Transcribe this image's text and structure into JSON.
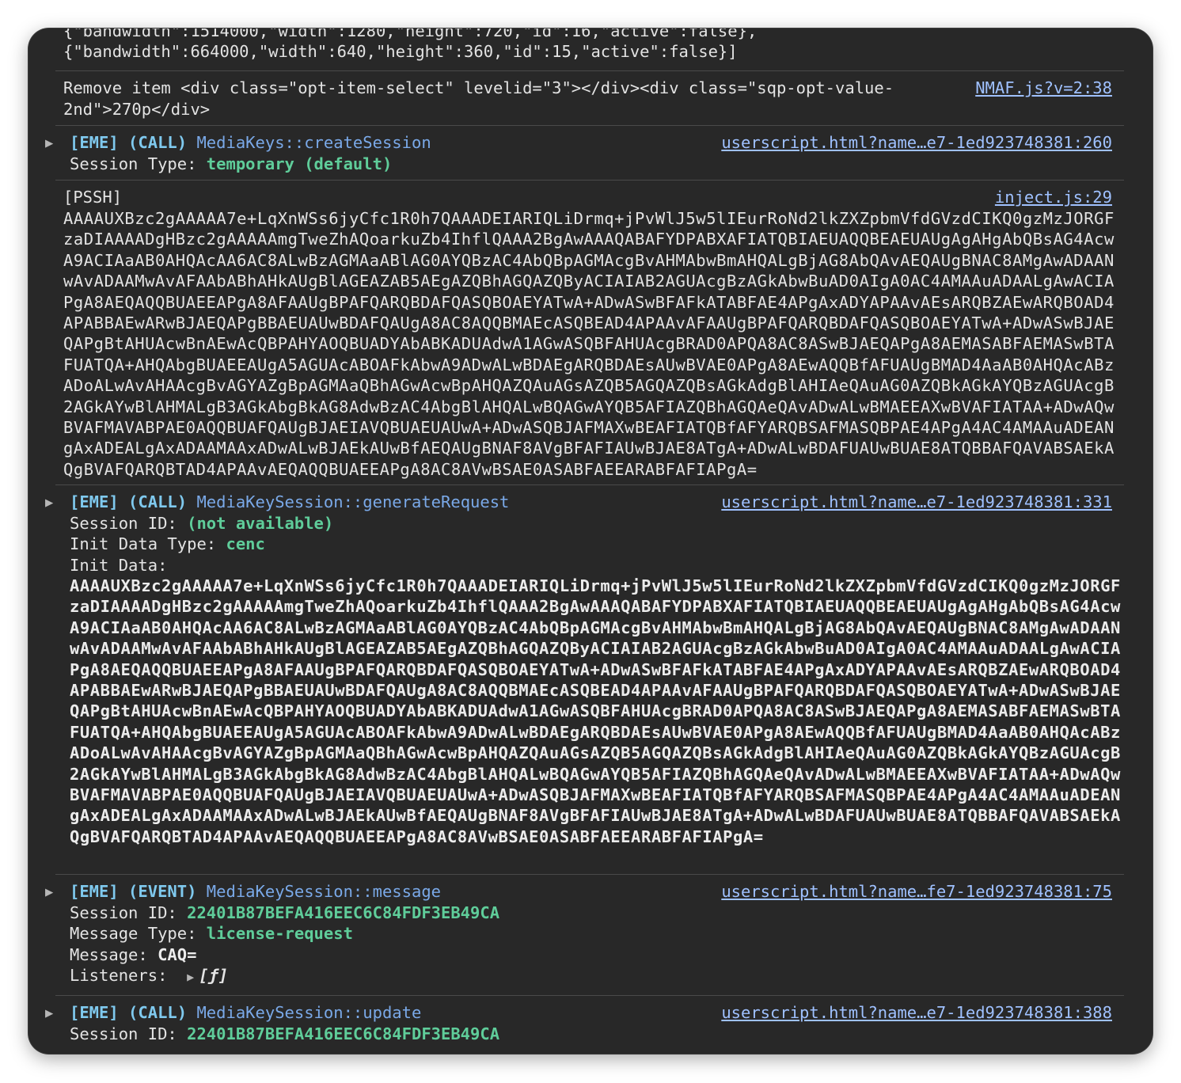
{
  "console": {
    "top_lines": [
      "{\"bandwidth\":1514000,\"width\":1280,\"height\":720,\"id\":16,\"active\":false},",
      "{\"bandwidth\":664000,\"width\":640,\"height\":360,\"id\":15,\"active\":false}]"
    ],
    "remove_item": {
      "line1": "Remove item <div class=\"opt-item-select\" levelid=\"3\"></div><div class=\"sqp-opt-value-",
      "line2": "2nd\">270p</div>",
      "source": "NMAF.js?v=2:38"
    },
    "create_session": {
      "prefix": "[EME] (CALL)",
      "method": "MediaKeys::createSession",
      "source": "userscript.html?name…e7-1ed923748381:260",
      "label": "Session Type:",
      "value": "temporary (default)"
    },
    "pssh": {
      "label": "[PSSH]",
      "source": "inject.js:29",
      "data": "AAAAUXBzc2gAAAAA7e+LqXnWSs6jyCfc1R0h7QAAADEIARIQLiDrmq+jPvWlJ5w5lIEurRoNd2lkZXZpbmVfdGVzdCIKQ0gzMzJORGFzaDIAAAADgHBzc2gAAAAAmgTweZhAQoarkuZb4IhflQAAA2BgAwAAAQABAFYDPABXAFIATQBIAEUAQQBEAEUAUgAgAHgAbQBsAG4AcwA9ACIAaAB0AHQAcAA6AC8ALwBzAGMAaABlAG0AYQBzAC4AbQBpAGMAcgBvAHMAbwBmAHQALgBjAG8AbQAvAEQAUgBNAC8AMgAwADAANwAvADAAMwAvAFAAbABhAHkAUgBlAGEAZAB5AEgAZQBhAGQAZQByACIAIAB2AGUAcgBzAGkAbwBuAD0AIgA0AC4AMAAuADAALgAwACIAPgA8AEQAQQBUAEEAPgA8AFAAUgBPAFQARQBDAFQASQBOAEYATwA+ADwASwBFAFkATABFAE4APgAxADYAPAAvAEsARQBZAEwARQBOAD4APABBAEwARwBJAEQAPgBBAEUAUwBDAFQAUgA8AC8AQQBMAEcASQBEAD4APAAvAFAAUgBPAFQARQBDAFQASQBOAEYATwA+ADwASwBJAEQAPgBtAHUAcwBnAEwAcQBPAHYAOQBUADYAbABKADUAdwA1AGwASQBFAHUAcgBRAD0APQA8AC8ASwBJAEQAPgA8AEMASABFAEMASwBTAFUATQA+AHQAbgBUAEEAUgA5AGUAcABOAFkAbwA9ADwALwBDAEgARQBDAEsAUwBVAE0APgA8AEwAQQBfAFUAUgBMAD4AaAB0AHQAcABzADoALwAvAHAAcgBvAGYAZgBpAGMAaQBhAGwAcwBpAHQAZQAuAGsAZQB5AGQAZQBsAGkAdgBlAHIAeQAuAG0AZQBkAGkAYQBzAGUAcgB2AGkAYwBlAHMALgB3AGkAbgBkAG8AdwBzAC4AbgBlAHQALwBQAGwAYQB5AFIAZQBhAGQAeQAvADwALwBMAEEAXwBVAFIATAA+ADwAQwBVAFMAVABPAE0AQQBUAFQAUgBJAEIAVQBUAEUAUwA+ADwASQBJAFMAXwBEAFIATQBfAFYARQBSAFMASQBPAE4APgA4AC4AMAAuADEANgAxADEALgAxADAAMAAxADwALwBJAEkAUwBfAEQAUgBNAF8AVgBFAFIAUwBJAE8ATgA+ADwALwBDAFUAUwBUAE8ATQBBAFQAVABSAEkAQgBVAFQARQBTAD4APAAvAEQAQQBUAEEAPgA8AC8AVwBSAE0ASABFAEEARABFAFIAPgA="
    },
    "generate_request": {
      "prefix": "[EME] (CALL)",
      "method": "MediaKeySession::generateRequest",
      "source": "userscript.html?name…e7-1ed923748381:331",
      "session_label": "Session ID:",
      "session_value": "(not available)",
      "init_type_label": "Init Data Type:",
      "init_type_value": "cenc",
      "init_data_label": "Init Data:",
      "init_data": "AAAAUXBzc2gAAAAA7e+LqXnWSs6jyCfc1R0h7QAAADEIARIQLiDrmq+jPvWlJ5w5lIEurRoNd2lkZXZpbmVfdGVzdCIKQ0gzMzJORGFzaDIAAAADgHBzc2gAAAAAmgTweZhAQoarkuZb4IhflQAAA2BgAwAAAQABAFYDPABXAFIATQBIAEUAQQBEAEUAUgAgAHgAbQBsAG4AcwA9ACIAaAB0AHQAcAA6AC8ALwBzAGMAaABlAG0AYQBzAC4AbQBpAGMAcgBvAHMAbwBmAHQALgBjAG8AbQAvAEQAUgBNAC8AMgAwADAANwAvADAAMwAvAFAAbABhAHkAUgBlAGEAZAB5AEgAZQBhAGQAZQByACIAIAB2AGUAcgBzAGkAbwBuAD0AIgA0AC4AMAAuADAALgAwACIAPgA8AEQAQQBUAEEAPgA8AFAAUgBPAFQARQBDAFQASQBOAEYATwA+ADwASwBFAFkATABFAE4APgAxADYAPAAvAEsARQBZAEwARQBOAD4APABBAEwARwBJAEQAPgBBAEUAUwBDAFQAUgA8AC8AQQBMAEcASQBEAD4APAAvAFAAUgBPAFQARQBDAFQASQBOAEYATwA+ADwASwBJAEQAPgBtAHUAcwBnAEwAcQBPAHYAOQBUADYAbABKADUAdwA1AGwASQBFAHUAcgBRAD0APQA8AC8ASwBJAEQAPgA8AEMASABFAEMASwBTAFUATQA+AHQAbgBUAEEAUgA5AGUAcABOAFkAbwA9ADwALwBDAEgARQBDAEsAUwBVAE0APgA8AEwAQQBfAFUAUgBMAD4AaAB0AHQAcABzADoALwAvAHAAcgBvAGYAZgBpAGMAaQBhAGwAcwBpAHQAZQAuAGsAZQB5AGQAZQBsAGkAdgBlAHIAeQAuAG0AZQBkAGkAYQBzAGUAcgB2AGkAYwBlAHMALgB3AGkAbgBkAG8AdwBzAC4AbgBlAHQALwBQAGwAYQB5AFIAZQBhAGQAeQAvADwALwBMAEEAXwBVAFIATAA+ADwAQwBVAFMAVABPAE0AQQBUAFQAUgBJAEIAVQBUAEUAUwA+ADwASQBJAFMAXwBEAFIATQBfAFYARQBSAFMASQBPAE4APgA4AC4AMAAuADEANgAxADEALgAxADAAMAAxADwALwBJAEkAUwBfAEQAUgBNAF8AVgBFAFIAUwBJAE8ATgA+ADwALwBDAFUAUwBUAE8ATQBBAFQAVABSAEkAQgBVAFQARQBTAD4APAAvAEQAQQBUAEEAPgA8AC8AVwBSAE0ASABFAEEARABFAFIAPgA="
    },
    "message_event": {
      "prefix": "[EME] (EVENT)",
      "method": "MediaKeySession::message",
      "source": "userscript.html?name…fe7-1ed923748381:75",
      "session_label": "Session ID:",
      "session_value": "22401B87BEFA416EEC6C84FDF3EB49CA",
      "type_label": "Message Type:",
      "type_value": "license-request",
      "message_label": "Message:",
      "message_value": "CAQ=",
      "listeners_label": "Listeners:",
      "listeners_value": "[ƒ]"
    },
    "update_call": {
      "prefix": "[EME] (CALL)",
      "method": "MediaKeySession::update",
      "source": "userscript.html?name…e7-1ed923748381:388",
      "session_label": "Session ID:",
      "session_value": "22401B87BEFA416EEC6C84FDF3EB49CA"
    }
  }
}
